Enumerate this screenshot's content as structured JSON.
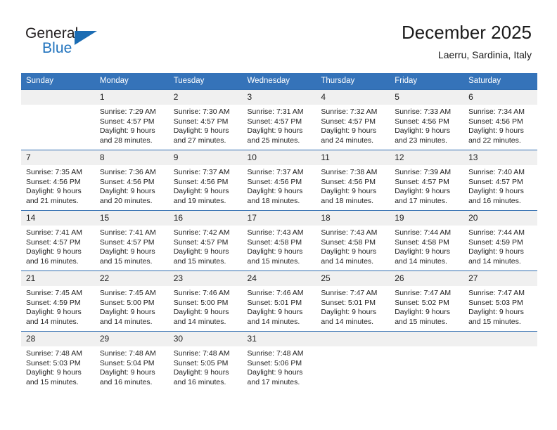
{
  "brand": {
    "name_part1": "General",
    "name_part2": "Blue",
    "logo_icon": "blue-triangle-icon",
    "accent_color": "#1b6cb3"
  },
  "header": {
    "title": "December 2025",
    "subtitle": "Laerru, Sardinia, Italy",
    "header_bg_color": "#3573b9",
    "grid_line_color": "#2f6cb0",
    "daynum_bg_color": "#f0f0f0"
  },
  "weekday_headers": [
    "Sunday",
    "Monday",
    "Tuesday",
    "Wednesday",
    "Thursday",
    "Friday",
    "Saturday"
  ],
  "weeks": [
    {
      "days": [
        {
          "num": "",
          "empty": true,
          "sunrise": "",
          "sunset": "",
          "daylight_line1": "",
          "daylight_line2": ""
        },
        {
          "num": "1",
          "empty": false,
          "sunrise": "Sunrise: 7:29 AM",
          "sunset": "Sunset: 4:57 PM",
          "daylight_line1": "Daylight: 9 hours",
          "daylight_line2": "and 28 minutes."
        },
        {
          "num": "2",
          "empty": false,
          "sunrise": "Sunrise: 7:30 AM",
          "sunset": "Sunset: 4:57 PM",
          "daylight_line1": "Daylight: 9 hours",
          "daylight_line2": "and 27 minutes."
        },
        {
          "num": "3",
          "empty": false,
          "sunrise": "Sunrise: 7:31 AM",
          "sunset": "Sunset: 4:57 PM",
          "daylight_line1": "Daylight: 9 hours",
          "daylight_line2": "and 25 minutes."
        },
        {
          "num": "4",
          "empty": false,
          "sunrise": "Sunrise: 7:32 AM",
          "sunset": "Sunset: 4:57 PM",
          "daylight_line1": "Daylight: 9 hours",
          "daylight_line2": "and 24 minutes."
        },
        {
          "num": "5",
          "empty": false,
          "sunrise": "Sunrise: 7:33 AM",
          "sunset": "Sunset: 4:56 PM",
          "daylight_line1": "Daylight: 9 hours",
          "daylight_line2": "and 23 minutes."
        },
        {
          "num": "6",
          "empty": false,
          "sunrise": "Sunrise: 7:34 AM",
          "sunset": "Sunset: 4:56 PM",
          "daylight_line1": "Daylight: 9 hours",
          "daylight_line2": "and 22 minutes."
        }
      ]
    },
    {
      "days": [
        {
          "num": "7",
          "empty": false,
          "sunrise": "Sunrise: 7:35 AM",
          "sunset": "Sunset: 4:56 PM",
          "daylight_line1": "Daylight: 9 hours",
          "daylight_line2": "and 21 minutes."
        },
        {
          "num": "8",
          "empty": false,
          "sunrise": "Sunrise: 7:36 AM",
          "sunset": "Sunset: 4:56 PM",
          "daylight_line1": "Daylight: 9 hours",
          "daylight_line2": "and 20 minutes."
        },
        {
          "num": "9",
          "empty": false,
          "sunrise": "Sunrise: 7:37 AM",
          "sunset": "Sunset: 4:56 PM",
          "daylight_line1": "Daylight: 9 hours",
          "daylight_line2": "and 19 minutes."
        },
        {
          "num": "10",
          "empty": false,
          "sunrise": "Sunrise: 7:37 AM",
          "sunset": "Sunset: 4:56 PM",
          "daylight_line1": "Daylight: 9 hours",
          "daylight_line2": "and 18 minutes."
        },
        {
          "num": "11",
          "empty": false,
          "sunrise": "Sunrise: 7:38 AM",
          "sunset": "Sunset: 4:56 PM",
          "daylight_line1": "Daylight: 9 hours",
          "daylight_line2": "and 18 minutes."
        },
        {
          "num": "12",
          "empty": false,
          "sunrise": "Sunrise: 7:39 AM",
          "sunset": "Sunset: 4:57 PM",
          "daylight_line1": "Daylight: 9 hours",
          "daylight_line2": "and 17 minutes."
        },
        {
          "num": "13",
          "empty": false,
          "sunrise": "Sunrise: 7:40 AM",
          "sunset": "Sunset: 4:57 PM",
          "daylight_line1": "Daylight: 9 hours",
          "daylight_line2": "and 16 minutes."
        }
      ]
    },
    {
      "days": [
        {
          "num": "14",
          "empty": false,
          "sunrise": "Sunrise: 7:41 AM",
          "sunset": "Sunset: 4:57 PM",
          "daylight_line1": "Daylight: 9 hours",
          "daylight_line2": "and 16 minutes."
        },
        {
          "num": "15",
          "empty": false,
          "sunrise": "Sunrise: 7:41 AM",
          "sunset": "Sunset: 4:57 PM",
          "daylight_line1": "Daylight: 9 hours",
          "daylight_line2": "and 15 minutes."
        },
        {
          "num": "16",
          "empty": false,
          "sunrise": "Sunrise: 7:42 AM",
          "sunset": "Sunset: 4:57 PM",
          "daylight_line1": "Daylight: 9 hours",
          "daylight_line2": "and 15 minutes."
        },
        {
          "num": "17",
          "empty": false,
          "sunrise": "Sunrise: 7:43 AM",
          "sunset": "Sunset: 4:58 PM",
          "daylight_line1": "Daylight: 9 hours",
          "daylight_line2": "and 15 minutes."
        },
        {
          "num": "18",
          "empty": false,
          "sunrise": "Sunrise: 7:43 AM",
          "sunset": "Sunset: 4:58 PM",
          "daylight_line1": "Daylight: 9 hours",
          "daylight_line2": "and 14 minutes."
        },
        {
          "num": "19",
          "empty": false,
          "sunrise": "Sunrise: 7:44 AM",
          "sunset": "Sunset: 4:58 PM",
          "daylight_line1": "Daylight: 9 hours",
          "daylight_line2": "and 14 minutes."
        },
        {
          "num": "20",
          "empty": false,
          "sunrise": "Sunrise: 7:44 AM",
          "sunset": "Sunset: 4:59 PM",
          "daylight_line1": "Daylight: 9 hours",
          "daylight_line2": "and 14 minutes."
        }
      ]
    },
    {
      "days": [
        {
          "num": "21",
          "empty": false,
          "sunrise": "Sunrise: 7:45 AM",
          "sunset": "Sunset: 4:59 PM",
          "daylight_line1": "Daylight: 9 hours",
          "daylight_line2": "and 14 minutes."
        },
        {
          "num": "22",
          "empty": false,
          "sunrise": "Sunrise: 7:45 AM",
          "sunset": "Sunset: 5:00 PM",
          "daylight_line1": "Daylight: 9 hours",
          "daylight_line2": "and 14 minutes."
        },
        {
          "num": "23",
          "empty": false,
          "sunrise": "Sunrise: 7:46 AM",
          "sunset": "Sunset: 5:00 PM",
          "daylight_line1": "Daylight: 9 hours",
          "daylight_line2": "and 14 minutes."
        },
        {
          "num": "24",
          "empty": false,
          "sunrise": "Sunrise: 7:46 AM",
          "sunset": "Sunset: 5:01 PM",
          "daylight_line1": "Daylight: 9 hours",
          "daylight_line2": "and 14 minutes."
        },
        {
          "num": "25",
          "empty": false,
          "sunrise": "Sunrise: 7:47 AM",
          "sunset": "Sunset: 5:01 PM",
          "daylight_line1": "Daylight: 9 hours",
          "daylight_line2": "and 14 minutes."
        },
        {
          "num": "26",
          "empty": false,
          "sunrise": "Sunrise: 7:47 AM",
          "sunset": "Sunset: 5:02 PM",
          "daylight_line1": "Daylight: 9 hours",
          "daylight_line2": "and 15 minutes."
        },
        {
          "num": "27",
          "empty": false,
          "sunrise": "Sunrise: 7:47 AM",
          "sunset": "Sunset: 5:03 PM",
          "daylight_line1": "Daylight: 9 hours",
          "daylight_line2": "and 15 minutes."
        }
      ]
    },
    {
      "days": [
        {
          "num": "28",
          "empty": false,
          "sunrise": "Sunrise: 7:48 AM",
          "sunset": "Sunset: 5:03 PM",
          "daylight_line1": "Daylight: 9 hours",
          "daylight_line2": "and 15 minutes."
        },
        {
          "num": "29",
          "empty": false,
          "sunrise": "Sunrise: 7:48 AM",
          "sunset": "Sunset: 5:04 PM",
          "daylight_line1": "Daylight: 9 hours",
          "daylight_line2": "and 16 minutes."
        },
        {
          "num": "30",
          "empty": false,
          "sunrise": "Sunrise: 7:48 AM",
          "sunset": "Sunset: 5:05 PM",
          "daylight_line1": "Daylight: 9 hours",
          "daylight_line2": "and 16 minutes."
        },
        {
          "num": "31",
          "empty": false,
          "sunrise": "Sunrise: 7:48 AM",
          "sunset": "Sunset: 5:06 PM",
          "daylight_line1": "Daylight: 9 hours",
          "daylight_line2": "and 17 minutes."
        },
        {
          "num": "",
          "empty": true,
          "sunrise": "",
          "sunset": "",
          "daylight_line1": "",
          "daylight_line2": ""
        },
        {
          "num": "",
          "empty": true,
          "sunrise": "",
          "sunset": "",
          "daylight_line1": "",
          "daylight_line2": ""
        },
        {
          "num": "",
          "empty": true,
          "sunrise": "",
          "sunset": "",
          "daylight_line1": "",
          "daylight_line2": ""
        }
      ]
    }
  ]
}
